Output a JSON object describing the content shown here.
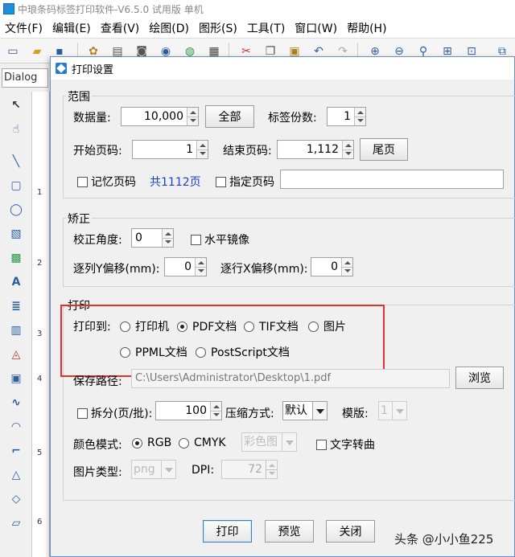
{
  "app": {
    "title": "中琅条码标签打印软件-V6.5.0 试用版 单机",
    "menus": [
      "文件(F)",
      "编辑(E)",
      "查看(V)",
      "绘图(D)",
      "图形(S)",
      "工具(T)",
      "窗口(W)",
      "帮助(H)"
    ],
    "font_box": "Dialog",
    "ruler_marks": [
      "1",
      "2",
      "3",
      "4",
      "5",
      "6"
    ]
  },
  "dialog": {
    "title": "打印设置",
    "range": {
      "group_label": "范围",
      "data_count_label": "数据量:",
      "data_count_value": "10,000",
      "all_button": "全部",
      "copies_label": "标签份数:",
      "copies_value": "1",
      "start_page_label": "开始页码:",
      "start_page_value": "1",
      "end_page_label": "结束页码:",
      "end_page_value": "1,112",
      "last_page_button": "尾页",
      "remember_page_label": "记忆页码",
      "total_pages": "共1112页",
      "specify_page_label": "指定页码",
      "specify_page_value": ""
    },
    "correct": {
      "group_label": "矫正",
      "angle_label": "校正角度:",
      "angle_value": "0",
      "mirror_label": "水平镜像",
      "col_offset_label": "逐列Y偏移(mm):",
      "col_offset_value": "0",
      "row_offset_label": "逐行X偏移(mm):",
      "row_offset_value": "0"
    },
    "print": {
      "group_label": "打印",
      "print_to_label": "打印到:",
      "targets": [
        "打印机",
        "PDF文档",
        "TIF文档",
        "图片",
        "PPML文档",
        "PostScript文档"
      ],
      "selected_target": "PDF文档",
      "save_path_label": "保存路径:",
      "save_path_value": "C:\\Users\\Administrator\\Desktop\\1.pdf",
      "browse_button": "浏览",
      "split_label": "拆分(页/批):",
      "split_value": "100",
      "compress_label": "压缩方式:",
      "compress_value": "默认",
      "template_label": "模版:",
      "template_value": "1",
      "color_mode_label": "颜色模式:",
      "color_modes": [
        "RGB",
        "CMYK"
      ],
      "selected_color_mode": "RGB",
      "color_profile_value": "彩色图",
      "text_to_curve_label": "文字转曲",
      "image_type_label": "图片类型:",
      "image_type_value": "png",
      "dpi_label": "DPI:",
      "dpi_value": "72"
    },
    "buttons": {
      "print": "打印",
      "preview": "预览",
      "close": "关闭"
    }
  },
  "watermark": "头条 @小小鱼225",
  "colors": {
    "highlight": "#e03030",
    "link_text": "#1a3fc8"
  }
}
